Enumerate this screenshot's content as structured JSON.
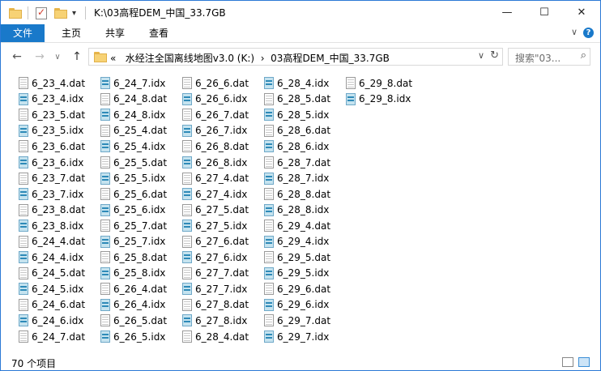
{
  "window": {
    "title": "K:\\03高程DEM_中国_33.7GB",
    "quick_access_dropdown": "▾",
    "minimize": "—",
    "maximize": "☐",
    "close": "✕"
  },
  "ribbon": {
    "tabs": [
      "文件",
      "主页",
      "共享",
      "查看"
    ],
    "active_tab": "文件",
    "accent_color": "#1979ca",
    "collapse": "∨",
    "help": "?"
  },
  "nav": {
    "back": "←",
    "forward": "→",
    "recent": "∨",
    "up": "↑"
  },
  "address": {
    "overflow": "«",
    "crumbs": [
      "水经注全国离线地图v3.0 (K:)",
      "03高程DEM_中国_33.7GB"
    ],
    "separator": "›",
    "dropdown": "∨",
    "refresh": "↻"
  },
  "search": {
    "placeholder": "搜索\"03...",
    "icon": "search-icon"
  },
  "files": [
    "6_23_4.dat",
    "6_23_4.idx",
    "6_23_5.dat",
    "6_23_5.idx",
    "6_23_6.dat",
    "6_23_6.idx",
    "6_23_7.dat",
    "6_23_7.idx",
    "6_23_8.dat",
    "6_23_8.idx",
    "6_24_4.dat",
    "6_24_4.idx",
    "6_24_5.dat",
    "6_24_5.idx",
    "6_24_6.dat",
    "6_24_6.idx",
    "6_24_7.dat",
    "6_24_7.idx",
    "6_24_8.dat",
    "6_24_8.idx",
    "6_25_4.dat",
    "6_25_4.idx",
    "6_25_5.dat",
    "6_25_5.idx",
    "6_25_6.dat",
    "6_25_6.idx",
    "6_25_7.dat",
    "6_25_7.idx",
    "6_25_8.dat",
    "6_25_8.idx",
    "6_26_4.dat",
    "6_26_4.idx",
    "6_26_5.dat",
    "6_26_5.idx",
    "6_26_6.dat",
    "6_26_6.idx",
    "6_26_7.dat",
    "6_26_7.idx",
    "6_26_8.dat",
    "6_26_8.idx",
    "6_27_4.dat",
    "6_27_4.idx",
    "6_27_5.dat",
    "6_27_5.idx",
    "6_27_6.dat",
    "6_27_6.idx",
    "6_27_7.dat",
    "6_27_7.idx",
    "6_27_8.dat",
    "6_27_8.idx",
    "6_28_4.dat",
    "6_28_4.idx",
    "6_28_5.dat",
    "6_28_5.idx",
    "6_28_6.dat",
    "6_28_6.idx",
    "6_28_7.dat",
    "6_28_7.idx",
    "6_28_8.dat",
    "6_28_8.idx",
    "6_29_4.dat",
    "6_29_4.idx",
    "6_29_5.dat",
    "6_29_5.idx",
    "6_29_6.dat",
    "6_29_6.idx",
    "6_29_7.dat",
    "6_29_7.idx",
    "6_29_8.dat",
    "6_29_8.idx"
  ],
  "files_per_column": 17,
  "status": {
    "count": "70 个项目"
  }
}
